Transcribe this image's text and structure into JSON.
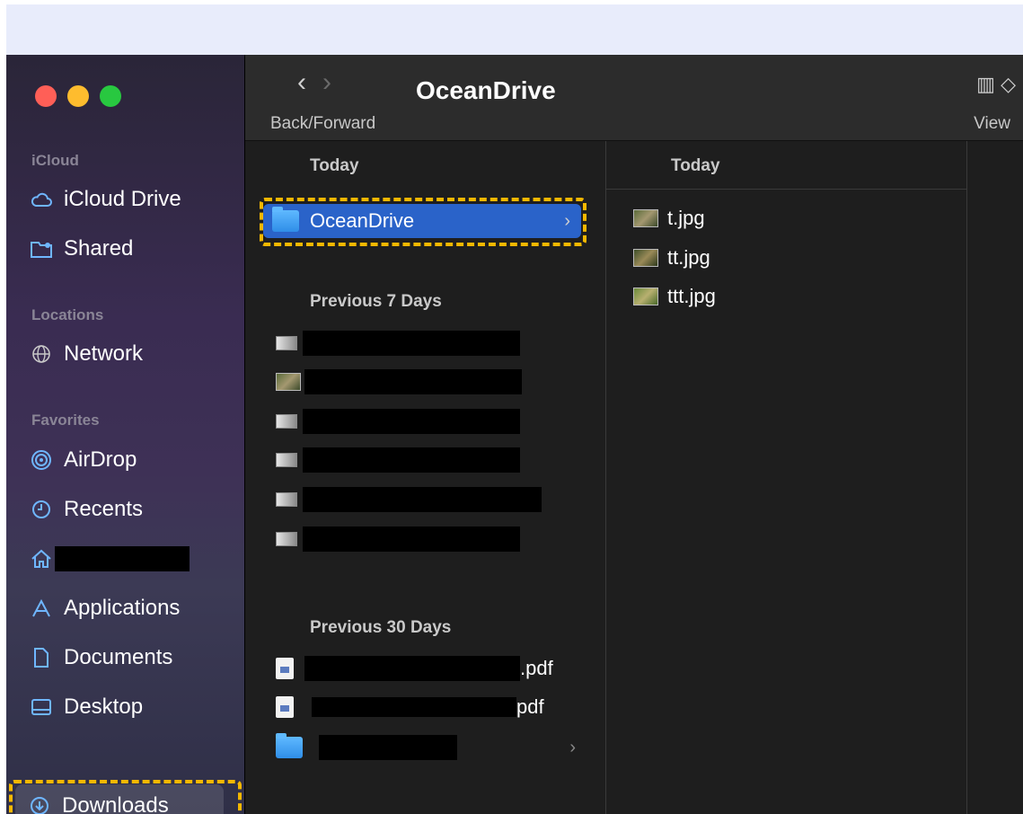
{
  "window": {
    "title": "OceanDrive",
    "back_forward_label": "Back/Forward",
    "view_label": "View",
    "view_icon": "columns-icon"
  },
  "sidebar": {
    "sections": [
      {
        "heading": "iCloud",
        "items": [
          {
            "label": "iCloud Drive",
            "icon": "cloud-icon"
          },
          {
            "label": "Shared",
            "icon": "shared-folder-icon"
          }
        ]
      },
      {
        "heading": "Locations",
        "items": [
          {
            "label": "Network",
            "icon": "globe-icon"
          }
        ]
      },
      {
        "heading": "Favorites",
        "items": [
          {
            "label": "AirDrop",
            "icon": "airdrop-icon"
          },
          {
            "label": "Recents",
            "icon": "clock-icon"
          },
          {
            "label": "",
            "icon": "home-icon",
            "redacted": true
          },
          {
            "label": "Applications",
            "icon": "applications-icon"
          },
          {
            "label": "Documents",
            "icon": "document-icon"
          },
          {
            "label": "Desktop",
            "icon": "desktop-icon"
          },
          {
            "label": "Downloads",
            "icon": "download-icon",
            "selected": true
          }
        ]
      }
    ]
  },
  "column1": {
    "groups": [
      {
        "heading": "Today",
        "items": [
          {
            "name": "OceanDrive",
            "type": "folder",
            "selected": true
          }
        ]
      },
      {
        "heading": "Previous 7 Days",
        "items": [
          {
            "name": "",
            "redacted": true
          },
          {
            "name": "",
            "redacted": true
          },
          {
            "name": "",
            "redacted": true
          },
          {
            "name": "",
            "redacted": true
          },
          {
            "name": "",
            "redacted": true
          },
          {
            "name": "",
            "redacted": true
          }
        ]
      },
      {
        "heading": "Previous 30 Days",
        "items": [
          {
            "name": ".pdf",
            "redacted_prefix": true
          },
          {
            "name": "pdf",
            "redacted_prefix": true
          },
          {
            "name": "",
            "redacted": true,
            "type": "folder"
          }
        ]
      }
    ]
  },
  "column2": {
    "heading": "Today",
    "items": [
      {
        "name": "t.jpg"
      },
      {
        "name": "tt.jpg"
      },
      {
        "name": "ttt.jpg"
      }
    ]
  },
  "colors": {
    "selection": "#2a63c9",
    "highlight": "#f5b800",
    "folder": "#3ea2f5"
  }
}
